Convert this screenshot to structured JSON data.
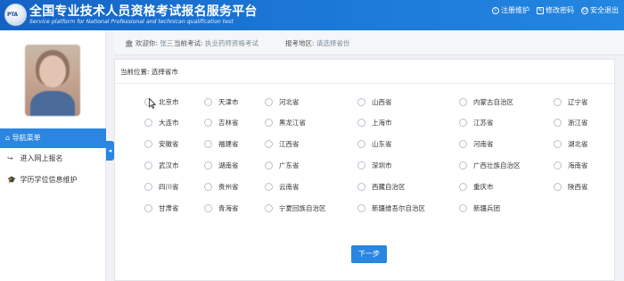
{
  "header": {
    "title": "全国专业技术人员资格考试报名服务平台",
    "subtitle": "Service platform for National Professional and technican qualification test",
    "logo_text": "PTA",
    "links": [
      {
        "label": "注册维护",
        "icon": "info-icon"
      },
      {
        "label": "修改密码",
        "icon": "edit-icon"
      },
      {
        "label": "安全退出",
        "icon": "power-icon"
      }
    ]
  },
  "sidebar": {
    "nav_title": "导航菜单",
    "items": [
      {
        "label": "进入网上报名",
        "icon": "share-arrow-icon"
      },
      {
        "label": "学历学位信息维护",
        "icon": "graduation-cap-icon"
      }
    ]
  },
  "infobar": {
    "welcome_label": "欢迎你:",
    "welcome_name": "张三",
    "exam_label": "当前考试:",
    "exam_value": "执业药师资格考试",
    "region_label": "报考地区:",
    "region_value": "请选择省份"
  },
  "main": {
    "breadcrumb": "当前位置: 选择省市",
    "next_button": "下一步",
    "rows": [
      [
        "北京市",
        "天津市",
        "河北省",
        "山西省",
        "内蒙古自治区",
        "辽宁省"
      ],
      [
        "大连市",
        "吉林省",
        "黑龙江省",
        "上海市",
        "江苏省",
        "浙江省"
      ],
      [
        "安徽省",
        "福建省",
        "江西省",
        "山东省",
        "河南省",
        "湖北省"
      ],
      [
        "武汉市",
        "湖南省",
        "广东省",
        "深圳市",
        "广西壮族自治区",
        "海南省"
      ],
      [
        "四川省",
        "贵州省",
        "云南省",
        "西藏自治区",
        "重庆市",
        "陕西省"
      ],
      [
        "甘肃省",
        "青海省",
        "宁夏回族自治区",
        "新疆维吾尔自治区",
        "新疆兵团"
      ]
    ]
  },
  "colors": {
    "header_blue": "#1b76d6",
    "accent": "#2a86e0"
  }
}
